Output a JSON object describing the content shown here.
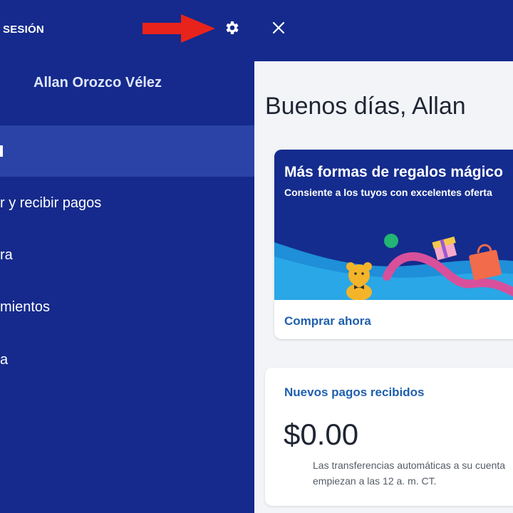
{
  "header": {
    "logout_label": "SESIÓN",
    "settings_icon": "gear-icon",
    "close_icon": "close-icon",
    "annotation_arrow_color": "#e8231b"
  },
  "sidebar": {
    "user_name": "Allan Orozco Vélez",
    "items": [
      {
        "label": "",
        "active": true
      },
      {
        "label": "r y recibir pagos"
      },
      {
        "label": "ra"
      },
      {
        "label": "mientos"
      },
      {
        "label": "a"
      }
    ]
  },
  "main": {
    "greeting": "Buenos días, Allan",
    "promo": {
      "title": "Más formas de regalos mágico",
      "subtitle": "Consiente a los tuyos con excelentes oferta",
      "link": "Comprar ahora"
    },
    "payments_card": {
      "title": "Nuevos pagos recibidos",
      "amount": "$0.00",
      "note_line1": "Las transferencias automáticas a su cuenta",
      "note_line2": "empiezan a las 12 a. m. CT."
    }
  },
  "colors": {
    "nav_bg": "#152a8c",
    "nav_active": "#2b43a6",
    "link": "#1f5fae",
    "main_bg": "#f2f4f8"
  }
}
